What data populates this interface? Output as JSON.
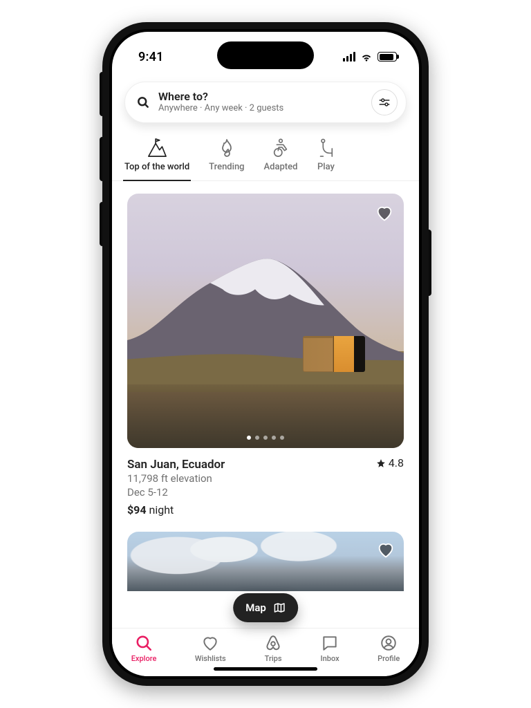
{
  "statusbar": {
    "time": "9:41"
  },
  "search": {
    "title": "Where to?",
    "subtitle": "Anywhere · Any week · 2 guests"
  },
  "categories": [
    {
      "id": "top-of-the-world",
      "label": "Top of the world",
      "active": true
    },
    {
      "id": "trending",
      "label": "Trending",
      "active": false
    },
    {
      "id": "adapted",
      "label": "Adapted",
      "active": false
    },
    {
      "id": "play",
      "label": "Play",
      "active": false
    }
  ],
  "listings": [
    {
      "location": "San Juan, Ecuador",
      "rating": "4.8",
      "sub1": "11,798 ft elevation",
      "sub2": "Dec 5-12",
      "price_amount": "$94",
      "price_unit": "night"
    }
  ],
  "map_button": {
    "label": "Map"
  },
  "tabs": [
    {
      "id": "explore",
      "label": "Explore",
      "active": true
    },
    {
      "id": "wishlists",
      "label": "Wishlists",
      "active": false
    },
    {
      "id": "trips",
      "label": "Trips",
      "active": false
    },
    {
      "id": "inbox",
      "label": "Inbox",
      "active": false
    },
    {
      "id": "profile",
      "label": "Profile",
      "active": false
    }
  ]
}
